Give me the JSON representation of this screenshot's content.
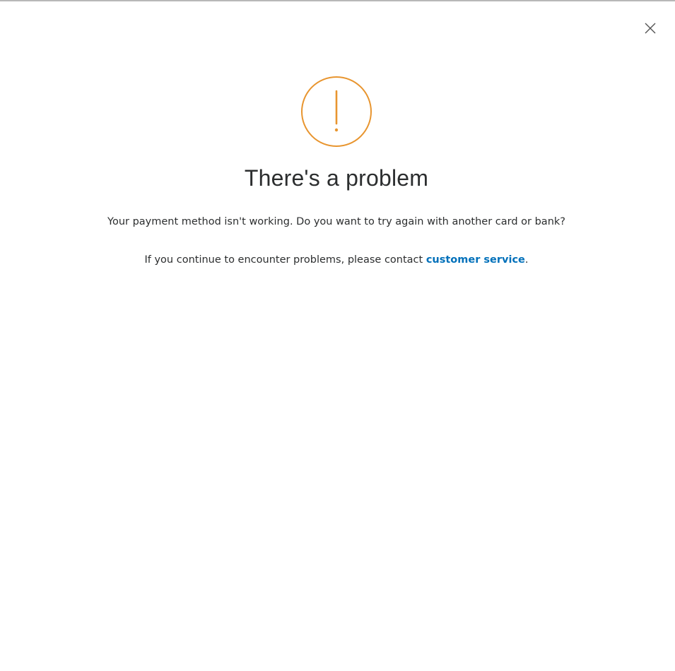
{
  "dialog": {
    "close_icon": "close-icon",
    "alert_icon": "exclamation-circle-icon",
    "alert_color": "#e8952f",
    "title": "There's a problem",
    "message": "Your payment method isn't working. Do you want to try again with another card or bank?",
    "contact_prefix": "If you continue to encounter problems, please contact ",
    "contact_link": "customer service",
    "contact_suffix": ".",
    "link_color": "#0070ba"
  }
}
